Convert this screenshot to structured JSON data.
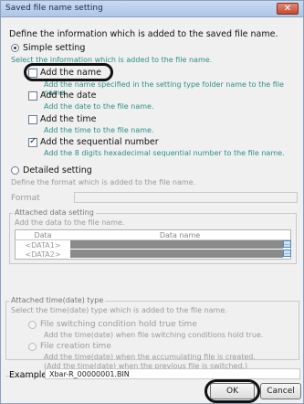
{
  "window": {
    "title": "Saved file name setting",
    "close_glyph": "✕"
  },
  "intro": "Define the information which is added to the saved file name.",
  "simple": {
    "label": "Simple setting",
    "desc": "Select the information which is added to the file name.",
    "options": [
      {
        "label": "Add the name",
        "desc": "Add the name specified in the setting type folder name to the file name.",
        "checked": false
      },
      {
        "label": "Add the date",
        "desc": "Add the date to the file name.",
        "checked": false
      },
      {
        "label": "Add the time",
        "desc": "Add the time to the file name.",
        "checked": false
      },
      {
        "label": "Add the sequential number",
        "desc": "Add the 8 digits hexadecimal sequential number to the file name.",
        "checked": true
      }
    ]
  },
  "detailed": {
    "label": "Detailed setting",
    "desc": "Define the format which is added to the file name.",
    "format_label": "Format",
    "format_value": "",
    "attached": {
      "title": "Attached data setting",
      "desc": "Add the data to the file name.",
      "headers": [
        "Data",
        "Data name"
      ],
      "rows": [
        {
          "data": "<DATA1>",
          "name": ""
        },
        {
          "data": "<DATA2>",
          "name": ""
        }
      ]
    }
  },
  "timetype": {
    "title": "Attached time(date) type",
    "desc": "Select the time(date) type which is added to the file name.",
    "options": [
      {
        "label": "File switching condition hold true time",
        "desc": "Add the time(date) when file switching conditions hold true."
      },
      {
        "label": "File creation time",
        "desc": "Add the time(date) when the accumulating file is created.",
        "desc2": "(Add the time(date) when the previous file is switched.)"
      }
    ]
  },
  "example": {
    "label": "Example",
    "value": "Xbar-R_00000001.BIN"
  },
  "buttons": {
    "ok": "OK",
    "cancel": "Cancel"
  },
  "colors": {
    "description_text": "#2d8f86",
    "annotation_oval": "#111111"
  }
}
